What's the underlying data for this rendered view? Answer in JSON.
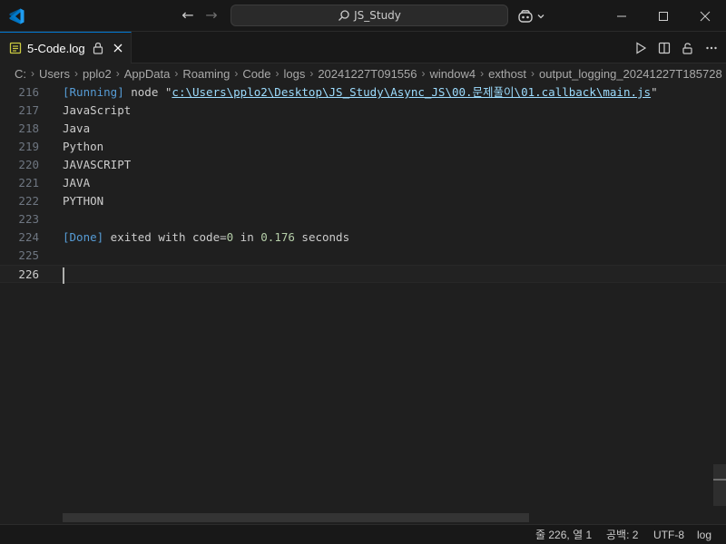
{
  "titlebar": {
    "search_text": "JS_Study"
  },
  "tab": {
    "label": "5-Code.log"
  },
  "breadcrumb": [
    "C:",
    "Users",
    "pplo2",
    "AppData",
    "Roaming",
    "Code",
    "logs",
    "20241227T091556",
    "window4",
    "exthost",
    "output_logging_20241227T185728"
  ],
  "editor": {
    "lines": [
      {
        "num": "216",
        "parts": [
          [
            "kw",
            "[Running]"
          ],
          [
            "txt",
            " node \""
          ],
          [
            "path",
            "c:\\Users\\pplo2\\Desktop\\JS_Study\\Async_JS\\00.문제풀이\\01.callback\\main.js"
          ],
          [
            "txt",
            "\""
          ]
        ]
      },
      {
        "num": "217",
        "parts": [
          [
            "txt",
            "JavaScript"
          ]
        ]
      },
      {
        "num": "218",
        "parts": [
          [
            "txt",
            "Java"
          ]
        ]
      },
      {
        "num": "219",
        "parts": [
          [
            "txt",
            "Python"
          ]
        ]
      },
      {
        "num": "220",
        "parts": [
          [
            "txt",
            "JAVASCRIPT"
          ]
        ]
      },
      {
        "num": "221",
        "parts": [
          [
            "txt",
            "JAVA"
          ]
        ]
      },
      {
        "num": "222",
        "parts": [
          [
            "txt",
            "PYTHON"
          ]
        ]
      },
      {
        "num": "223",
        "parts": []
      },
      {
        "num": "224",
        "parts": [
          [
            "kw",
            "[Done]"
          ],
          [
            "txt",
            " exited with code="
          ],
          [
            "num",
            "0"
          ],
          [
            "txt",
            " in "
          ],
          [
            "num",
            "0.176"
          ],
          [
            "txt",
            " seconds"
          ]
        ]
      },
      {
        "num": "225",
        "parts": []
      },
      {
        "num": "226",
        "parts": [],
        "current": true
      }
    ]
  },
  "statusbar": {
    "position": "줄 226, 열 1",
    "spaces": "공백: 2",
    "encoding": "UTF-8",
    "language": "log"
  },
  "colors": {
    "accent": "#0078d4",
    "keyword": "#569cd6",
    "number": "#b5cea8",
    "link": "#9cdcfe"
  }
}
